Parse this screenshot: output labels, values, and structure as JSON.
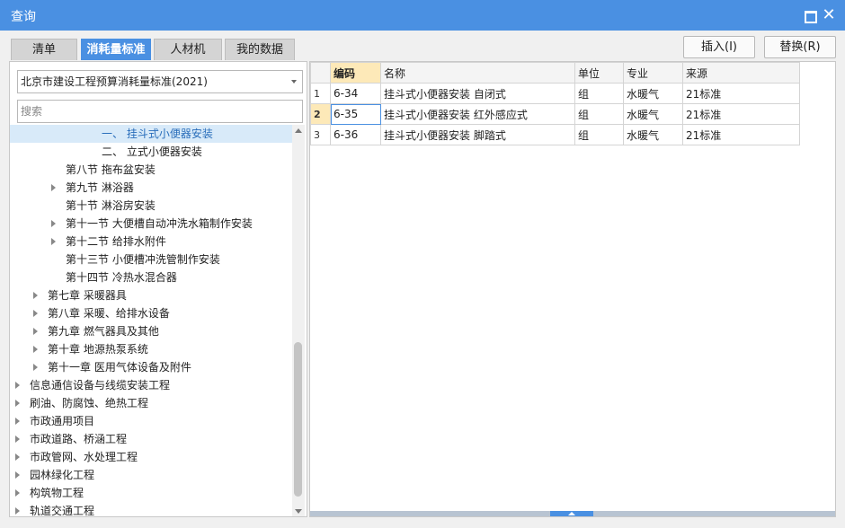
{
  "window": {
    "title": "查询"
  },
  "tabs": [
    {
      "label": "清单"
    },
    {
      "label": "消耗量标准",
      "active": true
    },
    {
      "label": "人材机"
    },
    {
      "label": "我的数据"
    }
  ],
  "buttons": {
    "insert": "插入(I)",
    "replace": "替换(R)"
  },
  "left": {
    "standard_select": "北京市建设工程预算消耗量标准(2021)",
    "search_placeholder": "搜索",
    "tree": [
      {
        "label": "一、 挂斗式小便器安装",
        "level": 4,
        "selected": true,
        "expandable": false
      },
      {
        "label": "二、 立式小便器安装",
        "level": 4,
        "expandable": false
      },
      {
        "label": "第八节 拖布盆安装",
        "level": 3,
        "expandable": false
      },
      {
        "label": "第九节 淋浴器",
        "level": 3,
        "expandable": true
      },
      {
        "label": "第十节 淋浴房安装",
        "level": 3,
        "expandable": false
      },
      {
        "label": "第十一节 大便槽自动冲洗水箱制作安装",
        "level": 3,
        "expandable": true
      },
      {
        "label": "第十二节 给排水附件",
        "level": 3,
        "expandable": true
      },
      {
        "label": "第十三节 小便槽冲洗管制作安装",
        "level": 3,
        "expandable": false
      },
      {
        "label": "第十四节 冷热水混合器",
        "level": 3,
        "expandable": false
      },
      {
        "label": "第七章 采暖器具",
        "level": 2,
        "expandable": true
      },
      {
        "label": "第八章 采暖、给排水设备",
        "level": 2,
        "expandable": true
      },
      {
        "label": "第九章 燃气器具及其他",
        "level": 2,
        "expandable": true
      },
      {
        "label": "第十章 地源热泵系统",
        "level": 2,
        "expandable": true
      },
      {
        "label": "第十一章 医用气体设备及附件",
        "level": 2,
        "expandable": true
      },
      {
        "label": "信息通信设备与线缆安装工程",
        "level": 1,
        "expandable": true
      },
      {
        "label": "刷油、防腐蚀、绝热工程",
        "level": 1,
        "expandable": true
      },
      {
        "label": "市政通用项目",
        "level": 1,
        "expandable": true
      },
      {
        "label": "市政道路、桥涵工程",
        "level": 1,
        "expandable": true
      },
      {
        "label": "市政管网、水处理工程",
        "level": 1,
        "expandable": true
      },
      {
        "label": "园林绿化工程",
        "level": 1,
        "expandable": true
      },
      {
        "label": "构筑物工程",
        "level": 1,
        "expandable": true
      },
      {
        "label": "轨道交通工程",
        "level": 1,
        "expandable": true
      }
    ]
  },
  "grid": {
    "headers": [
      "编码",
      "名称",
      "单位",
      "专业",
      "来源"
    ],
    "rows": [
      {
        "num": "1",
        "code": "6-34",
        "name": "挂斗式小便器安装 自闭式",
        "unit": "组",
        "major": "水暖气",
        "source": "21标准"
      },
      {
        "num": "2",
        "code": "6-35",
        "name": "挂斗式小便器安装 红外感应式",
        "unit": "组",
        "major": "水暖气",
        "source": "21标准",
        "selected": true
      },
      {
        "num": "3",
        "code": "6-36",
        "name": "挂斗式小便器安装 脚踏式",
        "unit": "组",
        "major": "水暖气",
        "source": "21标准"
      }
    ]
  }
}
